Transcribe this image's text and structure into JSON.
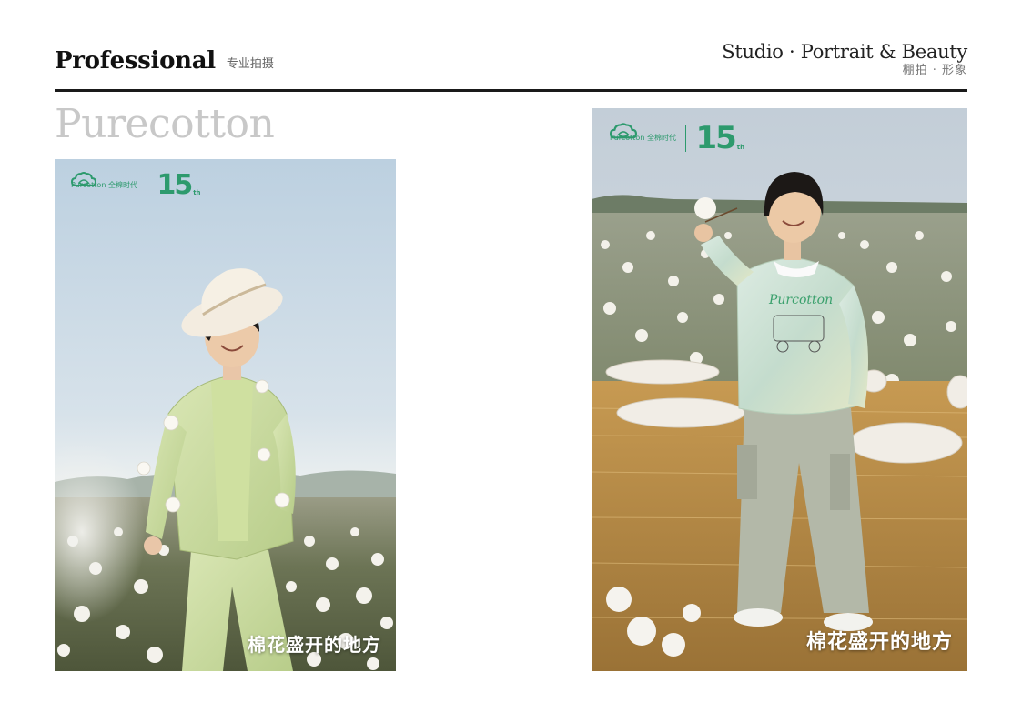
{
  "header": {
    "brand": "Professional",
    "brand_sub": "专业拍摄",
    "studio_title": "Studio · Portrait & Beauty",
    "studio_sub": "棚拍 · 形象"
  },
  "section": {
    "title": "Purecotton"
  },
  "photos": [
    {
      "logo_text": "Purcotton 全棉时代",
      "anniversary_number": "15",
      "anniversary_suffix": "th",
      "slogan": "棉花盛开的地方"
    },
    {
      "logo_text": "Purcotton 全棉时代",
      "anniversary_number": "15",
      "anniversary_suffix": "th",
      "slogan": "棉花盛开的地方",
      "sweater_print": "Purcotton"
    }
  ],
  "colors": {
    "brand_green": "#2d9a6d",
    "rule": "#1a1a1a",
    "section_title": "#c8c8c8"
  }
}
